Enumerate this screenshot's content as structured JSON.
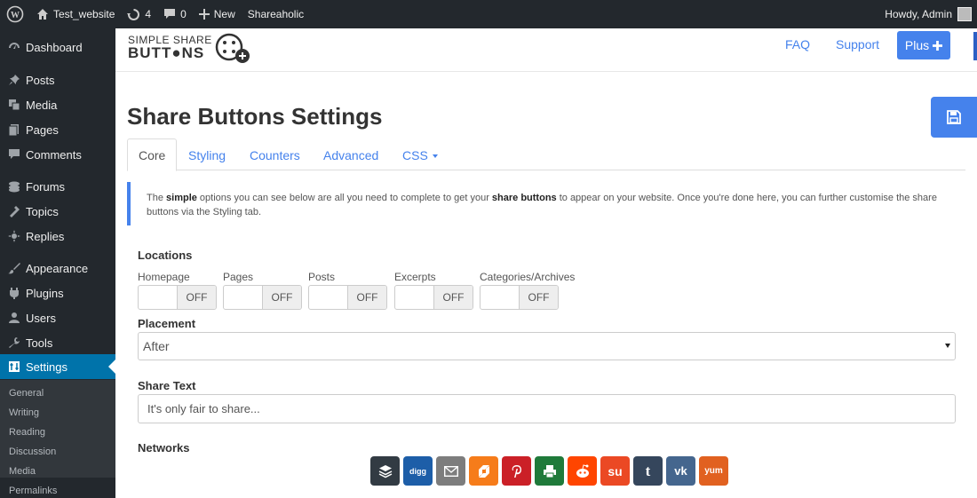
{
  "adminbar": {
    "site_name": "Test_website",
    "updates_count": "4",
    "comments_count": "0",
    "new_label": "New",
    "plugin_label": "Shareaholic",
    "howdy": "Howdy, Admin"
  },
  "sidebar": {
    "items": [
      {
        "label": "Dashboard",
        "icon": "dashboard-icon"
      },
      {
        "label": "Posts",
        "icon": "pin-icon"
      },
      {
        "label": "Media",
        "icon": "media-icon"
      },
      {
        "label": "Pages",
        "icon": "pages-icon"
      },
      {
        "label": "Comments",
        "icon": "comment-icon"
      },
      {
        "label": "Forums",
        "icon": "forums-icon"
      },
      {
        "label": "Topics",
        "icon": "topics-icon"
      },
      {
        "label": "Replies",
        "icon": "replies-icon"
      },
      {
        "label": "Appearance",
        "icon": "brush-icon"
      },
      {
        "label": "Plugins",
        "icon": "plugin-icon"
      },
      {
        "label": "Users",
        "icon": "user-icon"
      },
      {
        "label": "Tools",
        "icon": "wrench-icon"
      },
      {
        "label": "Settings",
        "icon": "settings-icon"
      }
    ],
    "submenu": [
      "General",
      "Writing",
      "Reading",
      "Discussion",
      "Media",
      "Permalinks"
    ]
  },
  "header": {
    "logo_line1": "SIMPLE SHARE",
    "logo_line2": "BUTT●NS",
    "faq": "FAQ",
    "support": "Support",
    "plus": "Plus"
  },
  "page": {
    "title": "Share Buttons Settings",
    "tabs": [
      "Core",
      "Styling",
      "Counters",
      "Advanced",
      "CSS"
    ],
    "info": {
      "part1": "The ",
      "bold1": "simple",
      "part2": " options you can see below are all you need to complete to get your ",
      "bold2": "share buttons",
      "part3": " to appear on your website. Once you're done here, you can further customise the share buttons via the Styling tab."
    },
    "locations_heading": "Locations",
    "locations": [
      {
        "label": "Homepage",
        "state": "OFF"
      },
      {
        "label": "Pages",
        "state": "OFF"
      },
      {
        "label": "Posts",
        "state": "OFF"
      },
      {
        "label": "Excerpts",
        "state": "OFF"
      },
      {
        "label": "Categories/Archives",
        "state": "OFF"
      }
    ],
    "placement_heading": "Placement",
    "placement_value": "After",
    "share_text_heading": "Share Text",
    "share_text_placeholder": "It's only fair to share...",
    "networks_heading": "Networks",
    "networks": [
      {
        "name": "buffer",
        "color": "#323b43",
        "glyph": "≡"
      },
      {
        "name": "digg",
        "color": "#1d5ea8",
        "glyph": "digg"
      },
      {
        "name": "email",
        "color": "#7d7d7d",
        "glyph": "✉"
      },
      {
        "name": "flattr",
        "color": "#f67c1a",
        "glyph": "◩"
      },
      {
        "name": "pinterest",
        "color": "#cb2027",
        "glyph": "P"
      },
      {
        "name": "print",
        "color": "#222222",
        "glyph": "⎙"
      },
      {
        "name": "reddit",
        "color": "#ff4500",
        "glyph": "●"
      },
      {
        "name": "stumbleupon",
        "color": "#eb4924",
        "glyph": "su"
      },
      {
        "name": "tumblr",
        "color": "#35465c",
        "glyph": "t"
      },
      {
        "name": "vk",
        "color": "#45668e",
        "glyph": "vk"
      },
      {
        "name": "yummly",
        "color": "#e16120",
        "glyph": "yum"
      }
    ]
  },
  "colors": {
    "accent": "#4582ec",
    "wp_dark": "#23282d",
    "wp_active": "#0073aa"
  }
}
